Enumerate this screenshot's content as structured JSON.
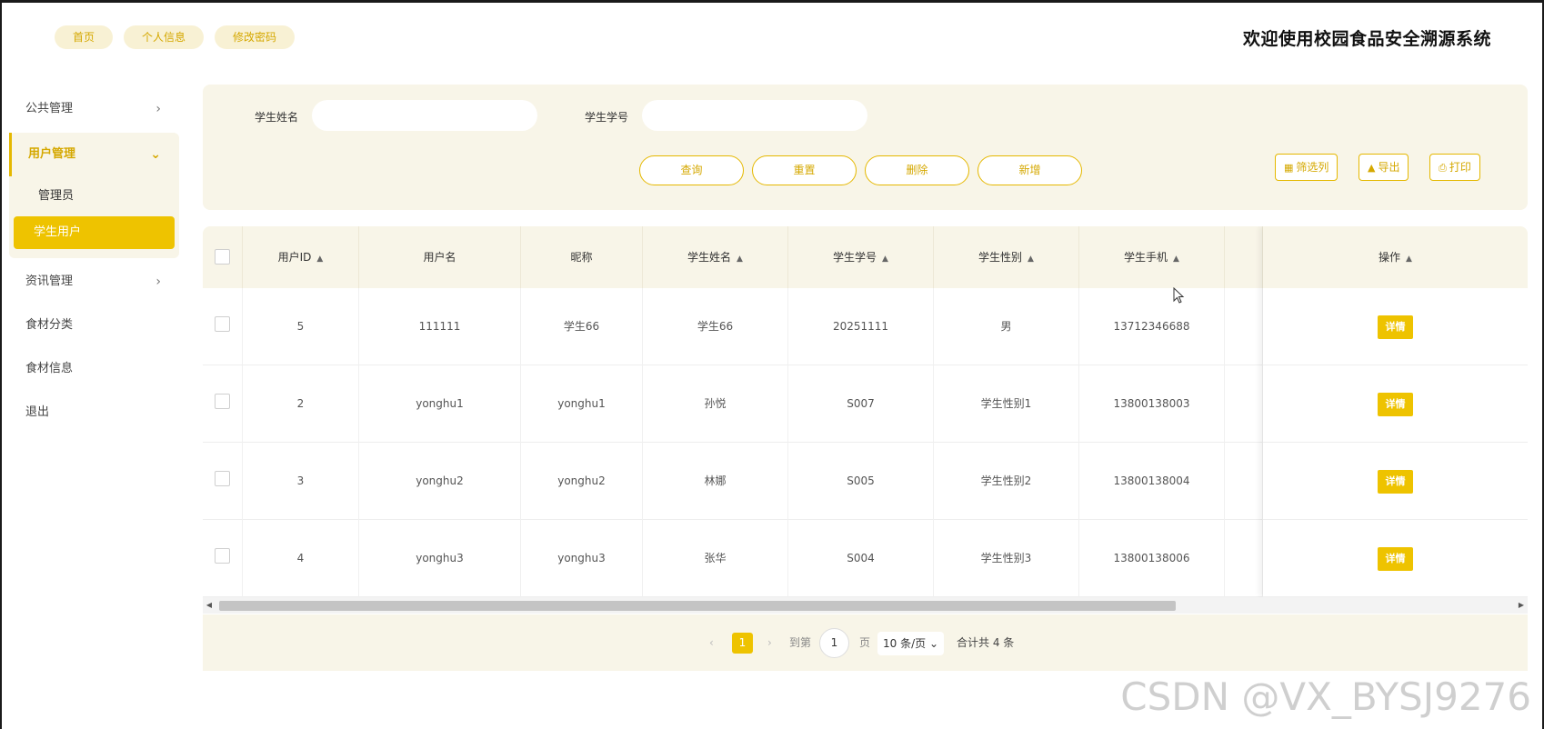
{
  "topnav": {
    "home": "首页",
    "profile": "个人信息",
    "password": "修改密码"
  },
  "site_title": "欢迎使用校园食品安全溯源系统",
  "sidebar": {
    "public": "公共管理",
    "users": "用户管理",
    "admin": "管理员",
    "students": "学生用户",
    "news": "资讯管理",
    "food_category": "食材分类",
    "food_info": "食材信息",
    "logout": "退出"
  },
  "search": {
    "name_label": "学生姓名",
    "number_label": "学生学号",
    "name_value": "",
    "number_value": ""
  },
  "actions": {
    "query": "查询",
    "reset": "重置",
    "delete": "删除",
    "add": "新增",
    "filter_cols": "筛选列",
    "export": "导出",
    "print": "打印"
  },
  "table": {
    "headers": {
      "user_id": "用户ID",
      "username": "用户名",
      "nickname": "昵称",
      "student_name": "学生姓名",
      "student_no": "学生学号",
      "gender": "学生性别",
      "phone": "学生手机",
      "ops": "操作"
    },
    "detail_label": "详情",
    "rows": [
      {
        "id": "5",
        "username": "111111",
        "nickname": "学生66",
        "name": "学生66",
        "number": "20251111",
        "gender": "男",
        "phone": "13712346688"
      },
      {
        "id": "2",
        "username": "yonghu1",
        "nickname": "yonghu1",
        "name": "孙悦",
        "number": "S007",
        "gender": "学生性别1",
        "phone": "13800138003"
      },
      {
        "id": "3",
        "username": "yonghu2",
        "nickname": "yonghu2",
        "name": "林娜",
        "number": "S005",
        "gender": "学生性别2",
        "phone": "13800138004"
      },
      {
        "id": "4",
        "username": "yonghu3",
        "nickname": "yonghu3",
        "name": "张华",
        "number": "S004",
        "gender": "学生性别3",
        "phone": "13800138006"
      }
    ]
  },
  "pagination": {
    "current": "1",
    "goto_label": "到第",
    "goto_value": "1",
    "page_suffix": "页",
    "page_size": "10 条/页",
    "total": "合计共 4 条"
  },
  "watermark": "CSDN @VX_BYSJ9276"
}
